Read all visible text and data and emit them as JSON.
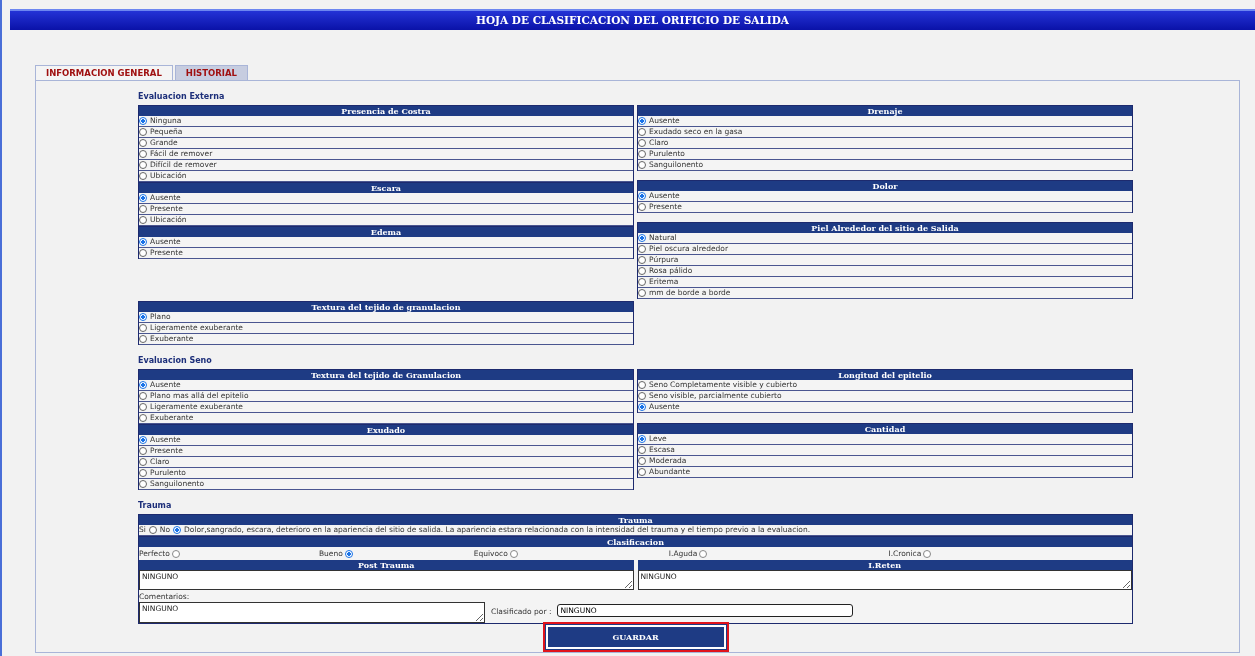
{
  "window": {
    "title": "HOJA DE CLASIFICACION DEL ORIFICIO DE SALIDA"
  },
  "tabs": [
    {
      "label": "INFORMACION GENERAL",
      "selected": true
    },
    {
      "label": "HISTORIAL",
      "selected": false
    }
  ],
  "external": {
    "heading": "Evaluacion Externa",
    "left": [
      {
        "title": "Presencia de Costra",
        "options": [
          {
            "label": "Ninguna",
            "selected": true
          },
          {
            "label": "Pequeña",
            "selected": false
          },
          {
            "label": "Grande",
            "selected": false
          },
          {
            "label": "Fácil de remover",
            "selected": false
          },
          {
            "label": "Difícil de remover",
            "selected": false
          },
          {
            "label": "Ubicación",
            "selected": false
          }
        ]
      },
      {
        "title": "Escara",
        "options": [
          {
            "label": "Ausente",
            "selected": true
          },
          {
            "label": "Presente",
            "selected": false
          },
          {
            "label": "Ubicación",
            "selected": false
          }
        ]
      },
      {
        "title": "Edema",
        "options": [
          {
            "label": "Ausente",
            "selected": true
          },
          {
            "label": "Presente",
            "selected": false
          }
        ]
      },
      {
        "title": "Textura del tejido de granulacion",
        "options": [
          {
            "label": "Plano",
            "selected": true
          },
          {
            "label": "Ligeramente exuberante",
            "selected": false
          },
          {
            "label": "Exuberante",
            "selected": false
          }
        ]
      }
    ],
    "right": [
      {
        "title": "Drenaje",
        "options": [
          {
            "label": "Ausente",
            "selected": true
          },
          {
            "label": "Exudado seco en la gasa",
            "selected": false
          },
          {
            "label": "Claro",
            "selected": false
          },
          {
            "label": "Purulento",
            "selected": false
          },
          {
            "label": "Sanguilonento",
            "selected": false
          }
        ]
      },
      {
        "title": "Dolor",
        "options": [
          {
            "label": "Ausente",
            "selected": true
          },
          {
            "label": "Presente",
            "selected": false
          }
        ]
      },
      {
        "title": "Piel Alrededor del sitio de Salida",
        "options": [
          {
            "label": "Natural",
            "selected": true
          },
          {
            "label": "Piel oscura alrededor",
            "selected": false
          },
          {
            "label": "Púrpura",
            "selected": false
          },
          {
            "label": "Rosa pálido",
            "selected": false
          },
          {
            "label": "Eritema",
            "selected": false
          },
          {
            "label": "mm de borde a borde",
            "selected": false
          }
        ]
      }
    ]
  },
  "sinus": {
    "heading": "Evaluacion Seno",
    "left": [
      {
        "title": "Textura del tejido de Granulacion",
        "options": [
          {
            "label": "Ausente",
            "selected": true
          },
          {
            "label": "Plano mas allá del epitelio",
            "selected": false
          },
          {
            "label": "Ligeramente exuberante",
            "selected": false
          },
          {
            "label": "Exuberante",
            "selected": false
          }
        ]
      },
      {
        "title": "Exudado",
        "options": [
          {
            "label": "Ausente",
            "selected": true
          },
          {
            "label": "Presente",
            "selected": false
          },
          {
            "label": "Claro",
            "selected": false
          },
          {
            "label": "Purulento",
            "selected": false
          },
          {
            "label": "Sanguilonento",
            "selected": false
          }
        ]
      }
    ],
    "right": [
      {
        "title": "Longitud del epitelio",
        "options": [
          {
            "label": "Seno Completamente visible y cubierto",
            "selected": false
          },
          {
            "label": "Seno visible, parcialmente cubierto",
            "selected": false
          },
          {
            "label": "Ausente",
            "selected": true
          }
        ]
      },
      {
        "title": "Cantidad",
        "options": [
          {
            "label": "Leve",
            "selected": true
          },
          {
            "label": "Escasa",
            "selected": false
          },
          {
            "label": "Moderada",
            "selected": false
          },
          {
            "label": "Abundante",
            "selected": false
          }
        ]
      }
    ]
  },
  "trauma": {
    "heading": "Trauma",
    "title": "Trauma",
    "options": [
      {
        "label": "Si",
        "selected": false
      },
      {
        "label": "No",
        "selected": true
      }
    ],
    "description": "Dolor,sangrado, escara, deterioro en la apariencia del sitio de salida. La apariencia estara relacionada con la intensidad del trauma y el tiempo previo a la evaluacion."
  },
  "classification": {
    "title": "Clasificacion",
    "options": [
      {
        "label": "Perfecto",
        "selected": false
      },
      {
        "label": "Bueno",
        "selected": true
      },
      {
        "label": "Equivoco",
        "selected": false
      },
      {
        "label": "I.Aguda",
        "selected": false
      },
      {
        "label": "I.Cronica",
        "selected": false
      }
    ]
  },
  "post_trauma": {
    "title": "Post Trauma",
    "value": "NINGUNO"
  },
  "i_reten": {
    "title": "I.Reten",
    "value": "NINGUNO"
  },
  "comments": {
    "label": "Comentarios:",
    "value": "NINGUNO"
  },
  "classified_by": {
    "label": "Clasificado por :",
    "value": "NINGUNO"
  },
  "save_button": {
    "label": "GUARDAR",
    "highlighted": true
  }
}
